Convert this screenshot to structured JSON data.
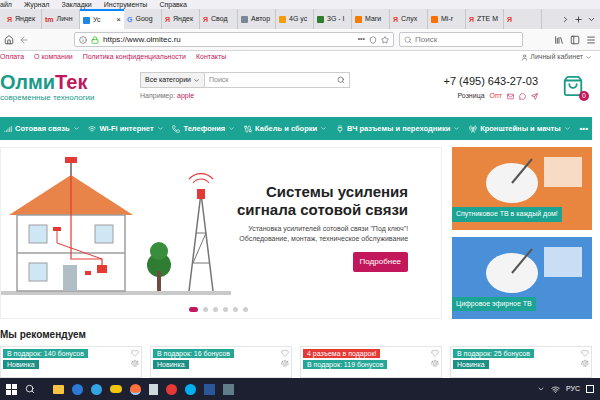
{
  "browser": {
    "menu": [
      "айл",
      "Журнал",
      "Закладки",
      "Инструменты",
      "Справка"
    ],
    "tabs": [
      {
        "label": "Яндек",
        "selected": false,
        "icon": "Я",
        "color": "#e53935"
      },
      {
        "label": "Личн",
        "selected": false,
        "icon": "tm",
        "color": "#d32f2f"
      },
      {
        "label": "Ус",
        "selected": true,
        "color": "#1e88e5"
      },
      {
        "label": "Goog",
        "selected": false,
        "icon": "G",
        "color": "#4285f4"
      },
      {
        "label": "Яндек",
        "selected": false,
        "icon": "Я",
        "color": "#e53935"
      },
      {
        "label": "Свод",
        "selected": false,
        "icon": "Я",
        "color": "#e53935"
      },
      {
        "label": "Автор",
        "selected": false,
        "color": "#7b8794"
      },
      {
        "label": "4G ус",
        "selected": false,
        "color": "#f39c12"
      },
      {
        "label": "3G - I",
        "selected": false,
        "color": "#2e7d32"
      },
      {
        "label": "Маги",
        "selected": false,
        "color": "#f57c00"
      },
      {
        "label": "Слух",
        "selected": false,
        "icon": "Я",
        "color": "#e53935"
      },
      {
        "label": "Mi-r",
        "selected": false,
        "color": "#ff6f00"
      },
      {
        "label": "ZTE M",
        "selected": false,
        "icon": "Я",
        "color": "#e53935"
      },
      {
        "label": "",
        "selected": false,
        "icon": "Я",
        "color": "#e53935"
      }
    ],
    "tab_close": "×",
    "url": "https://www.olmitec.ru",
    "page_actions": "•••",
    "search_placeholder": "Поиск"
  },
  "site": {
    "top_links": [
      "Оплата",
      "О компании",
      "Политика конфиденциальности",
      "Контакты"
    ],
    "account": "Личный кабинет",
    "logo": {
      "first": "Олми",
      "second": "Тек",
      "tagline": "современные технологии"
    },
    "search": {
      "category": "Все категории",
      "placeholder": "Поиск",
      "hint_label": "Например:",
      "hint_value": "apple"
    },
    "phone": "+7 (495) 643-27-03",
    "sales_links": [
      {
        "label": "Розница",
        "color": "#333333"
      },
      {
        "label": "Опт",
        "color": "#e53935"
      }
    ],
    "cart_count": "0",
    "nav": [
      "Сотовая связь",
      "Wi-Fi интернет",
      "Телефония",
      "Кабель и сборки",
      "ВЧ разъемы и переходники",
      "Кронштейны и мачты"
    ],
    "nav_more": "•••",
    "hero": {
      "title_lines": [
        "Системы усиления",
        "сигнала сотовой связи"
      ],
      "text_lines": [
        "Установка усилителей сотовой связи \"Под ключ\"!",
        "Обследование, монтаж, техническое обслуживание"
      ],
      "button": "Подробнее",
      "dots": [
        {
          "selected": true
        },
        {
          "selected": false
        },
        {
          "selected": false
        },
        {
          "selected": false
        },
        {
          "selected": false
        },
        {
          "selected": false
        }
      ]
    },
    "promos": [
      {
        "label": "Спутниковое ТВ в каждый дом!",
        "color": "#e8863f"
      },
      {
        "label": "Цифровое эфирное ТВ",
        "color": "#4a90d9"
      }
    ],
    "recommend": {
      "title": "Мы рекомендуем",
      "products": [
        {
          "badges": [
            {
              "text": "В подарок: 140 бонусов",
              "kind": "bonus"
            },
            {
              "text": "Новинка",
              "kind": "new"
            }
          ]
        },
        {
          "badges": [
            {
              "text": "В подарок: 16 бонусов",
              "kind": "bonus"
            },
            {
              "text": "Новинка",
              "kind": "new"
            }
          ]
        },
        {
          "badges": [
            {
              "text": "4 разъема в подарок!",
              "kind": "gift"
            },
            {
              "text": "В подарок: 119 бонусов",
              "kind": "bonus"
            }
          ]
        },
        {
          "badges": [
            {
              "text": "В подарок: 25 бонусов",
              "kind": "bonus"
            },
            {
              "text": "Новинка",
              "kind": "new"
            }
          ]
        }
      ]
    }
  },
  "taskbar": {
    "language": "РУС"
  }
}
